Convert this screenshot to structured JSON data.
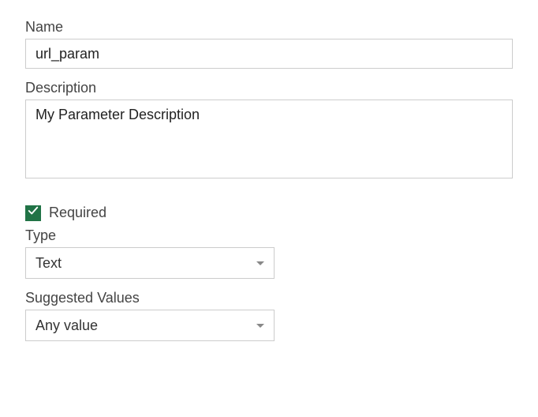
{
  "name": {
    "label": "Name",
    "value": "url_param"
  },
  "description": {
    "label": "Description",
    "value": "My Parameter Description"
  },
  "required": {
    "label": "Required",
    "checked": true
  },
  "type": {
    "label": "Type",
    "value": "Text"
  },
  "suggested": {
    "label": "Suggested Values",
    "value": "Any value"
  },
  "colors": {
    "accent": "#217346"
  }
}
